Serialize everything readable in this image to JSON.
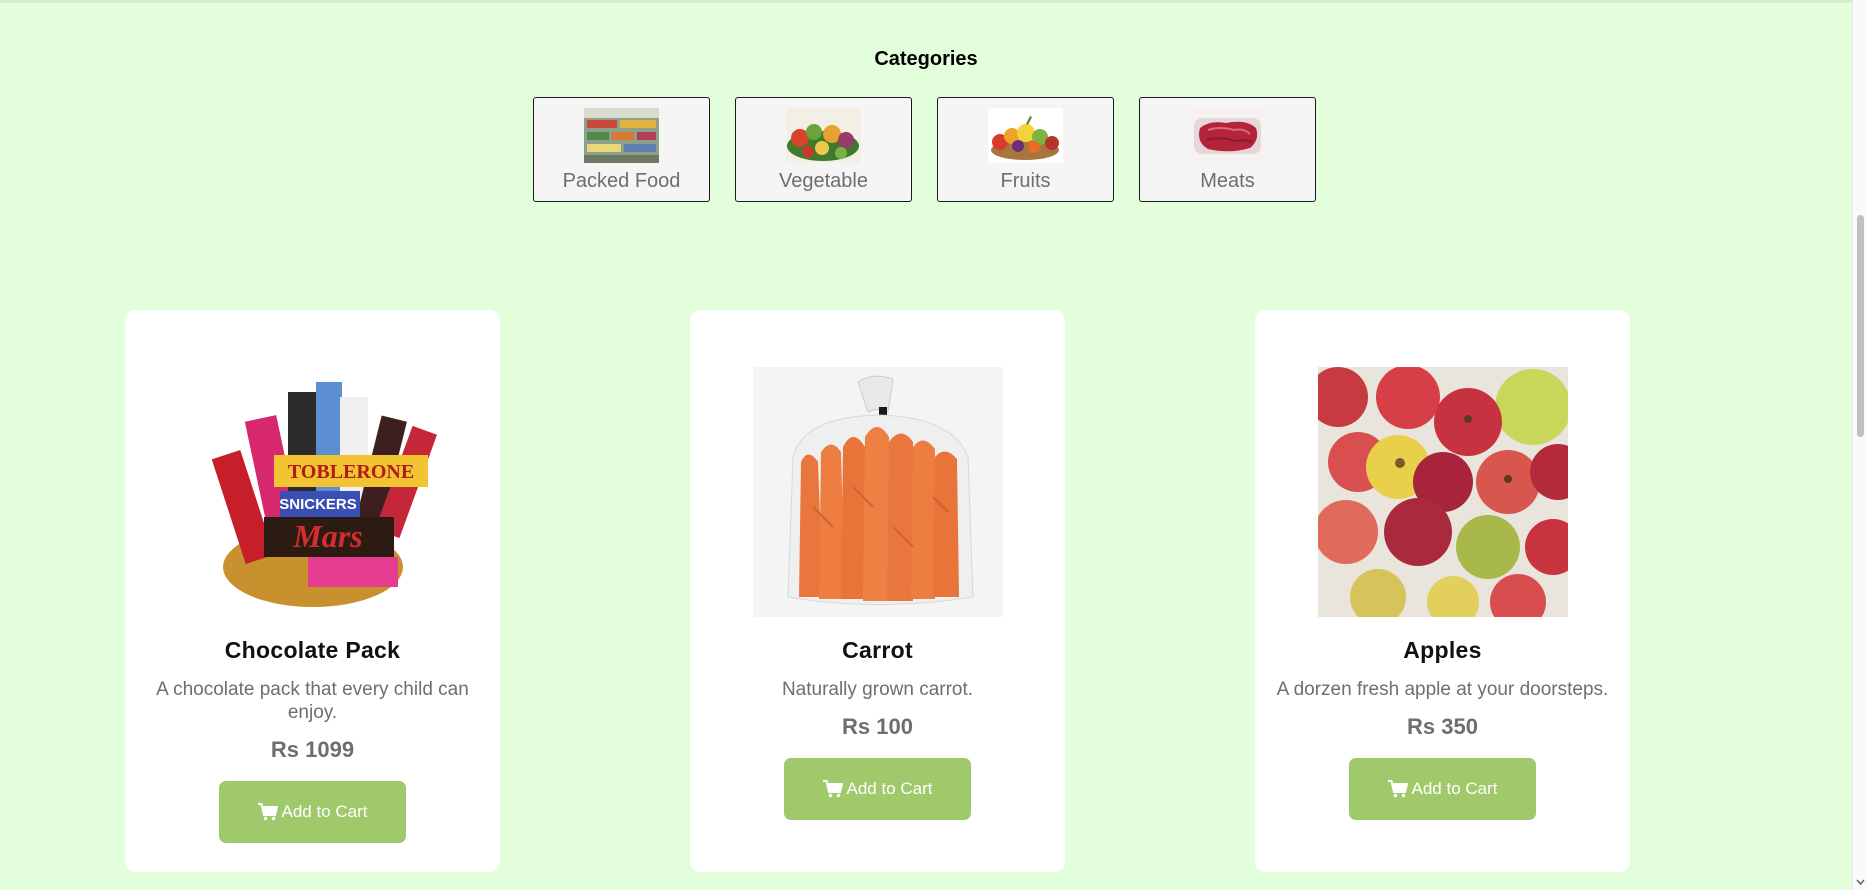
{
  "categories": {
    "title": "Categories",
    "items": [
      {
        "label": "Packed Food",
        "icon": "packed-food-image"
      },
      {
        "label": "Vegetable",
        "icon": "vegetable-image"
      },
      {
        "label": "Fruits",
        "icon": "fruits-image"
      },
      {
        "label": "Meats",
        "icon": "meats-image"
      }
    ]
  },
  "products": [
    {
      "name": "Chocolate Pack",
      "description": "A chocolate pack that every child can enjoy.",
      "price": "Rs 1099",
      "button": "Add to Cart",
      "image": "chocolate-pack-image"
    },
    {
      "name": "Carrot",
      "description": "Naturally grown carrot.",
      "price": "Rs 100",
      "button": "Add to Cart",
      "image": "carrot-image"
    },
    {
      "name": "Apples",
      "description": "A dorzen fresh apple at your doorsteps.",
      "price": "Rs 350",
      "button": "Add to Cart",
      "image": "apples-image"
    }
  ],
  "colors": {
    "background": "#e3fedb",
    "button": "#9fc96b",
    "muted_text": "#6e6e6e"
  }
}
